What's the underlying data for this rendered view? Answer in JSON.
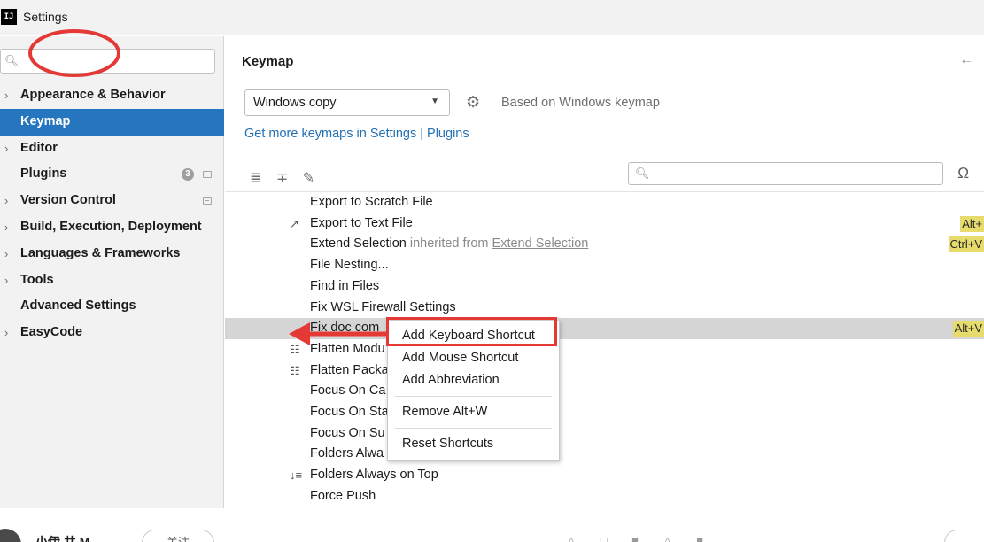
{
  "window": {
    "title": "Settings",
    "app_icon": "IJ"
  },
  "sidebar": {
    "search_placeholder": "",
    "items": [
      {
        "label": "Appearance & Behavior",
        "expandable": true
      },
      {
        "label": "Keymap",
        "expandable": false,
        "selected": true
      },
      {
        "label": "Editor",
        "expandable": true
      },
      {
        "label": "Plugins",
        "expandable": false,
        "badge": "3"
      },
      {
        "label": "Version Control",
        "expandable": true
      },
      {
        "label": "Build, Execution, Deployment",
        "expandable": true
      },
      {
        "label": "Languages & Frameworks",
        "expandable": true
      },
      {
        "label": "Tools",
        "expandable": true
      },
      {
        "label": "Advanced Settings",
        "expandable": false
      },
      {
        "label": "EasyCode",
        "expandable": true
      }
    ]
  },
  "main": {
    "title": "Keymap",
    "keymap_select": "Windows copy",
    "based_on": "Based on Windows keymap",
    "keymaps_link": "Get more keymaps in Settings | Plugins",
    "actions": [
      {
        "label": "Export to Scratch File"
      },
      {
        "label": "Export to Text File",
        "icon": "export-icon",
        "shortcut": "Alt+"
      },
      {
        "label": "Extend Selection",
        "inherited_text": "inherited from",
        "inherited_link": "Extend Selection",
        "shortcut": "Ctrl+V"
      },
      {
        "label": "File Nesting..."
      },
      {
        "label": "Find in Files"
      },
      {
        "label": "Fix WSL Firewall Settings"
      },
      {
        "label": "Fix doc com",
        "selected": true,
        "shortcut": "Alt+V"
      },
      {
        "label": "Flatten Modu",
        "icon": "flatten-modules-icon"
      },
      {
        "label": "Flatten Packa",
        "icon": "flatten-packages-icon"
      },
      {
        "label": "Focus On Ca"
      },
      {
        "label": "Focus On Sta"
      },
      {
        "label": "Focus On Su"
      },
      {
        "label": "Folders Alwa"
      },
      {
        "label": "Folders Always on Top",
        "icon": "sort-icon"
      },
      {
        "label": "Force Push"
      }
    ]
  },
  "context_menu": {
    "items": [
      "Add Keyboard Shortcut",
      "Add Mouse Shortcut",
      "Add Abbreviation",
      "Remove Alt+W",
      "Reset Shortcuts"
    ]
  },
  "bottom_bar": {
    "author": "小伊 共 M",
    "follow_label": "关注"
  },
  "colors": {
    "selection": "#2675bf",
    "shortcut_bg": "#e6db6b",
    "link": "#2470b3",
    "annotation": "#e53935"
  }
}
